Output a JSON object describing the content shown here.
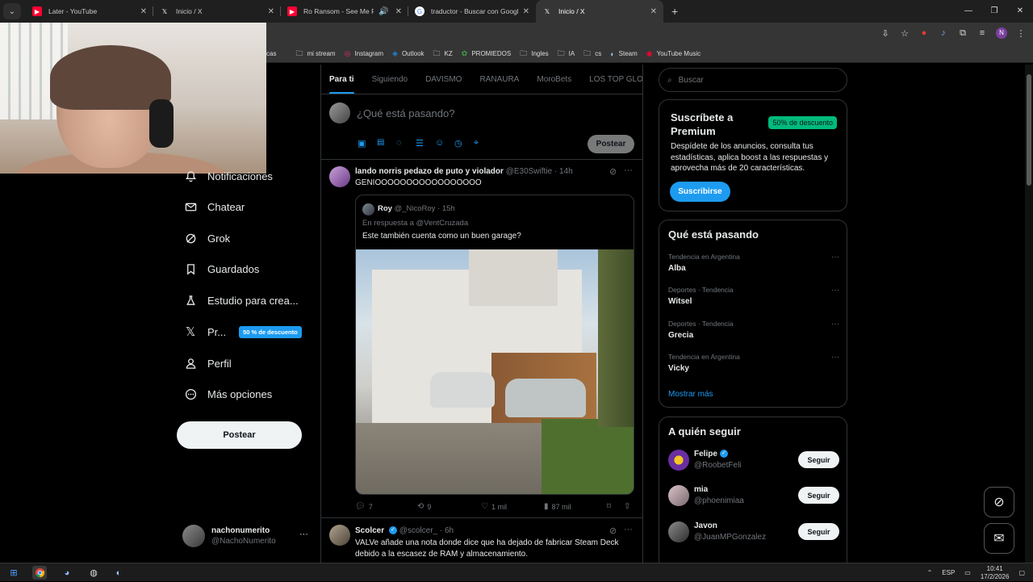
{
  "browser": {
    "tabs": [
      {
        "title": "Later - YouTube",
        "icon": "youtube-icon",
        "color": "#ff0033",
        "active": false
      },
      {
        "title": "Inicio / X",
        "icon": "x-logo-icon",
        "color": "#ffffff",
        "active": false
      },
      {
        "title": "Ro Ransom - See Me Fall ft",
        "icon": "youtube-icon",
        "color": "#ff0033",
        "active": false
      },
      {
        "title": "traductor - Buscar con Google",
        "icon": "google-icon",
        "color": "#4285f4",
        "active": false
      },
      {
        "title": "Inicio / X",
        "icon": "x-logo-icon",
        "color": "#ffffff",
        "active": true
      }
    ],
    "profile_initial": "N",
    "bookmarks": [
      {
        "label": "cas",
        "icon": ""
      },
      {
        "label": "mi stream",
        "icon": "folder-icon"
      },
      {
        "label": "Instagram",
        "icon": "instagram-icon"
      },
      {
        "label": "Outlook",
        "icon": "outlook-icon"
      },
      {
        "label": "KZ",
        "icon": "folder-icon"
      },
      {
        "label": "PROMIEDOS",
        "icon": "promiedos-icon"
      },
      {
        "label": "Ingles",
        "icon": "folder-icon"
      },
      {
        "label": "IA",
        "icon": "folder-icon"
      },
      {
        "label": "cs",
        "icon": "folder-icon"
      },
      {
        "label": "Steam",
        "icon": "steam-icon"
      },
      {
        "label": "YouTube Music",
        "icon": "youtube-music-icon"
      }
    ]
  },
  "nav": {
    "items": [
      {
        "label": "Notificaciones",
        "icon": "bell-icon"
      },
      {
        "label": "Chatear",
        "icon": "mail-icon"
      },
      {
        "label": "Grok",
        "icon": "grok-icon"
      },
      {
        "label": "Guardados",
        "icon": "bookmark-icon"
      },
      {
        "label": "Estudio para crea...",
        "icon": "flask-icon"
      },
      {
        "label": "Pr...",
        "icon": "x-logo-icon"
      },
      {
        "label": "Perfil",
        "icon": "person-icon"
      },
      {
        "label": "Más opciones",
        "icon": "more-circle-icon"
      }
    ],
    "premium_badge": "50 % de descuento",
    "post_button": "Postear",
    "account": {
      "name": "nachonumerito",
      "handle": "@NachoNumerito"
    }
  },
  "feed": {
    "tabs": [
      "Para ti",
      "Siguiendo",
      "DAVISMO",
      "RANAURA",
      "MoroBets",
      "LOS TOP GLOBA"
    ],
    "composer_placeholder": "¿Qué está pasando?",
    "composer_post": "Postear",
    "tweet1": {
      "name": "lando norris pedazo de puto y violador",
      "handle": "@E30Swiftie",
      "time": "· 14h",
      "text": "GENIOOOOOOOOOOOOOOOOO",
      "quote": {
        "name": "Roy",
        "handle": "@_NicoRoy",
        "time": "· 15h",
        "reply_to": "En respuesta a @VentCruzada",
        "text": "Este también cuenta como un buen garage?"
      },
      "stats": {
        "replies": "7",
        "reposts": "9",
        "likes": "1 mil",
        "views": "87 mil"
      }
    },
    "tweet2": {
      "name": "Scolcer",
      "handle": "@scolcer_",
      "time": "· 6h",
      "text": "VALVe añade una nota donde dice que ha dejado de fabricar Steam Deck debido a la escasez de RAM y almacenamiento."
    }
  },
  "sidebar": {
    "search_placeholder": "Buscar",
    "premium": {
      "title": "Suscríbete a Premium",
      "badge": "50% de descuento",
      "text": "Despídete de los anuncios, consulta tus estadísticas, aplica boost a las respuestas y aprovecha más de 20 características.",
      "button": "Suscribirse"
    },
    "trends": {
      "title": "Qué está pasando",
      "items": [
        {
          "context": "Tendencia en Argentina",
          "name": "Alba"
        },
        {
          "context": "Deportes · Tendencia",
          "name": "Witsel"
        },
        {
          "context": "Deportes · Tendencia",
          "name": "Grecia"
        },
        {
          "context": "Tendencia en Argentina",
          "name": "Vicky"
        }
      ],
      "more": "Mostrar más"
    },
    "follow": {
      "title": "A quién seguir",
      "users": [
        {
          "name": "Felipe",
          "handle": "@RoobetFeli",
          "button": "Seguir"
        },
        {
          "name": "mia",
          "handle": "@phoenimiaa",
          "button": "Seguir"
        },
        {
          "name": "Javon",
          "handle": "@JuanMPGonzalez",
          "button": "Seguir"
        }
      ]
    }
  },
  "taskbar": {
    "lang": "ESP",
    "time": "10:41",
    "date": "17/2/2026"
  }
}
